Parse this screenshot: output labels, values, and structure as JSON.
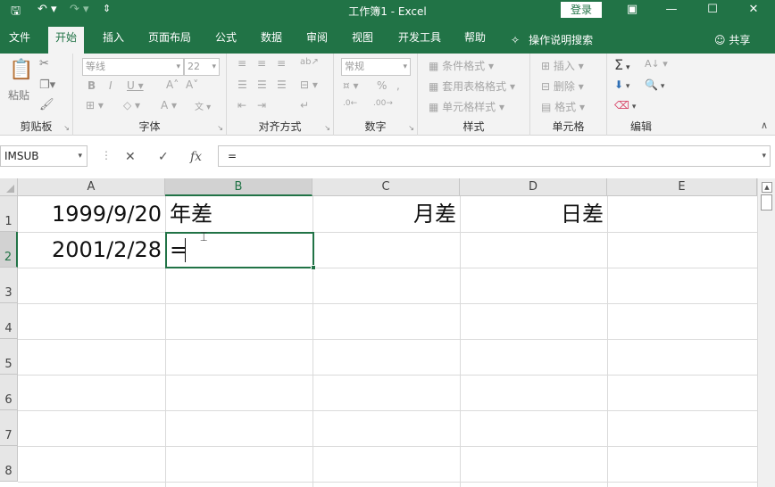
{
  "titlebar": {
    "title": "工作簿1  -  Excel",
    "login_label": "登录",
    "undo_label": "↶ ▾",
    "redo_label": "↷ ▾",
    "customize_label": "⇕"
  },
  "tabs": [
    "文件",
    "开始",
    "插入",
    "页面布局",
    "公式",
    "数据",
    "审阅",
    "视图",
    "开发工具",
    "帮助"
  ],
  "tell_me": "操作说明搜索",
  "share_label": "共享",
  "ribbon": {
    "clipboard": {
      "label": "剪贴板",
      "paste_label": "粘贴"
    },
    "font": {
      "label": "字体",
      "font_name": "等线",
      "font_size": "22"
    },
    "alignment": {
      "label": "对齐方式"
    },
    "number": {
      "label": "数字",
      "format": "常规"
    },
    "styles": {
      "label": "样式",
      "conditional": "条件格式",
      "table_format": "套用表格格式",
      "cell_styles": "单元格样式"
    },
    "cells": {
      "label": "单元格",
      "insert": "插入",
      "delete": "删除",
      "format": "格式"
    },
    "editing": {
      "label": "编辑"
    }
  },
  "formula_bar": {
    "name_box": "IMSUB",
    "cancel": "✕",
    "enter": "✓",
    "fx": "fx",
    "content": "="
  },
  "grid": {
    "columns": [
      "A",
      "B",
      "C",
      "D",
      "E"
    ],
    "rows": [
      "1",
      "2",
      "3",
      "4",
      "5",
      "6",
      "7",
      "8"
    ],
    "cells": {
      "A1": "1999/9/20",
      "B1": "年差",
      "C1": "月差",
      "D1": "日差",
      "A2": "2001/2/28",
      "B2": "="
    },
    "selected_cell": "B2"
  }
}
